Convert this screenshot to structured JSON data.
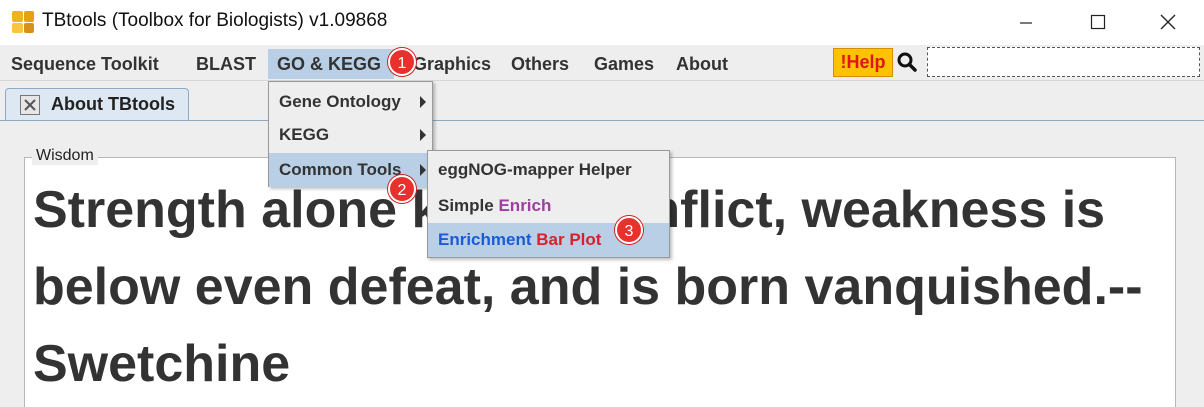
{
  "window": {
    "title": "TBtools (Toolbox for Biologists) v1.09868"
  },
  "menubar": {
    "items": [
      "Sequence Toolkit",
      "BLAST",
      "GO & KEGG",
      "Graphics",
      "Others",
      "Games",
      "About"
    ],
    "help_label": "!Help",
    "search_placeholder": ""
  },
  "tabs": {
    "active_label": "About TBtools"
  },
  "wisdom": {
    "legend": "Wisdom",
    "text": "Strength alone knows conflict, weakness is below even defeat, and is born vanquished.--Swetchine"
  },
  "go_kegg_menu": {
    "items": [
      "Gene Ontology",
      "KEGG",
      "Common Tools"
    ]
  },
  "common_tools_menu": {
    "item1": "eggNOG-mapper Helper",
    "item2_a": "Simple ",
    "item2_b": "Enrich",
    "item3_a": "Enrichment ",
    "item3_b": "Bar Plot"
  },
  "badges": [
    "1",
    "2",
    "3"
  ],
  "colors": {
    "menu_highlight": "#b8cfe5",
    "help_bg": "#ffc200",
    "help_text": "#e0141c",
    "enrich_purple": "#9c3fa0",
    "enrichment_blue": "#1c5bd6",
    "barplot_red": "#d8222a",
    "badge_red": "#e8302d"
  }
}
